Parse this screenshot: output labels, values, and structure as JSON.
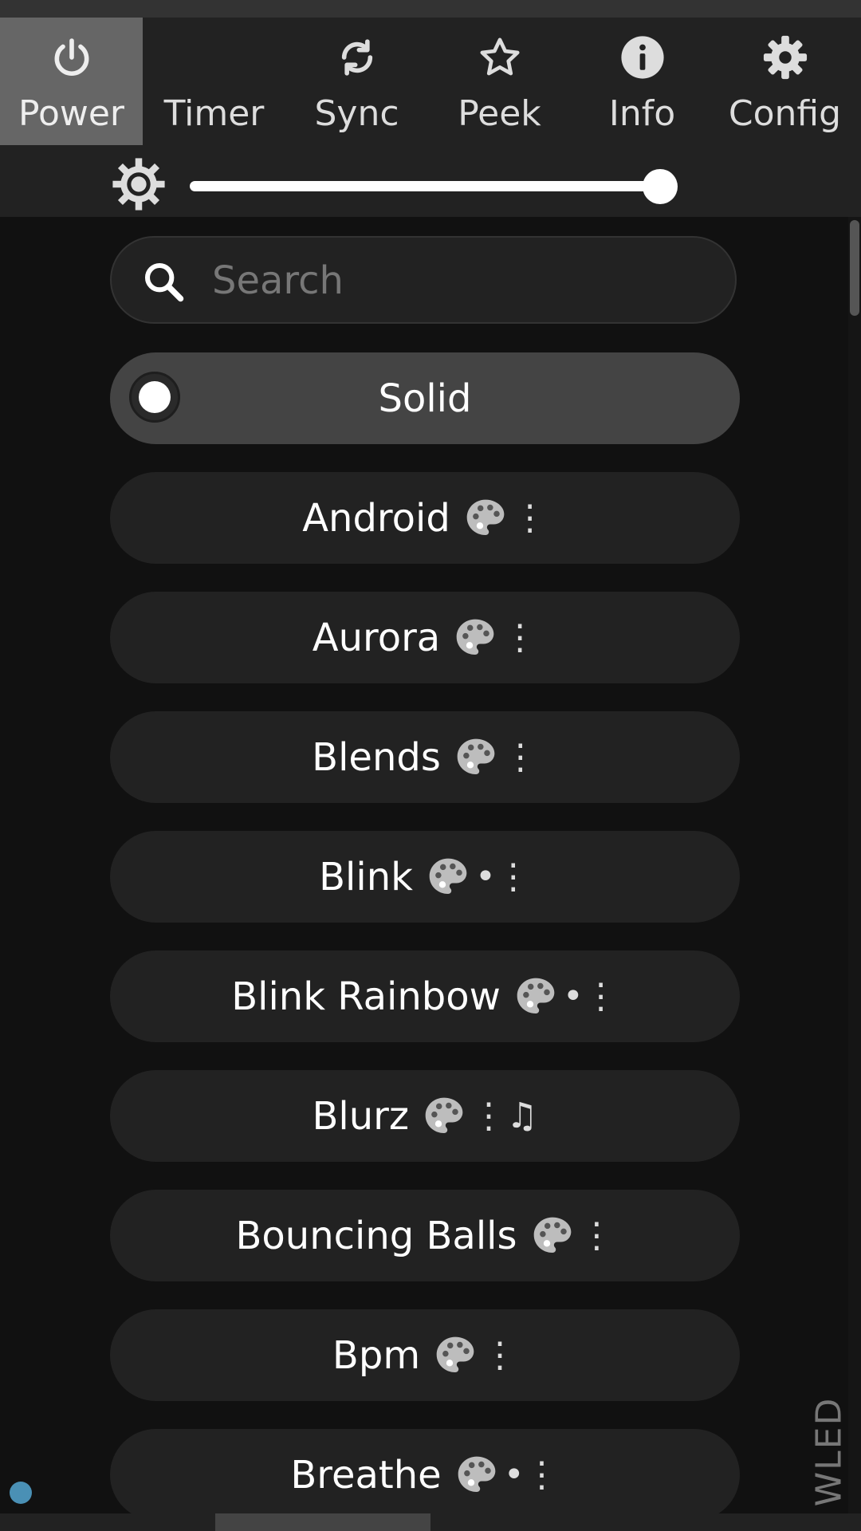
{
  "tabs": [
    {
      "label": "Power",
      "icon": "power-icon"
    },
    {
      "label": "Timer",
      "icon": "moon-icon"
    },
    {
      "label": "Sync",
      "icon": "sync-icon"
    },
    {
      "label": "Peek",
      "icon": "star-icon"
    },
    {
      "label": "Info",
      "icon": "info-icon"
    },
    {
      "label": "Config",
      "icon": "gear-icon"
    }
  ],
  "active_tab": "Power",
  "brightness": {
    "icon": "sun-icon",
    "value_percent": 100
  },
  "search": {
    "placeholder": "Search",
    "value": ""
  },
  "effects": [
    {
      "name": "Solid",
      "flags": "",
      "palette": false,
      "selected": true
    },
    {
      "name": "Android",
      "flags": "⋮",
      "palette": true
    },
    {
      "name": "Aurora",
      "flags": "⋮",
      "palette": true
    },
    {
      "name": "Blends",
      "flags": "⋮",
      "palette": true
    },
    {
      "name": "Blink",
      "flags": "•⋮",
      "palette": true
    },
    {
      "name": "Blink Rainbow",
      "flags": "•⋮",
      "palette": true
    },
    {
      "name": "Blurz",
      "flags": "⋮♫",
      "palette": true
    },
    {
      "name": "Bouncing Balls",
      "flags": "⋮",
      "palette": true
    },
    {
      "name": "Bpm",
      "flags": "⋮",
      "palette": true
    },
    {
      "name": "Breathe",
      "flags": "•⋮",
      "palette": true
    }
  ],
  "brand": "WLED",
  "colors": {
    "background": "#111111",
    "header": "#222222",
    "active_tab": "#666666",
    "item": "#222222",
    "selected_item": "#444444",
    "status_dot": "#4a90b5"
  }
}
